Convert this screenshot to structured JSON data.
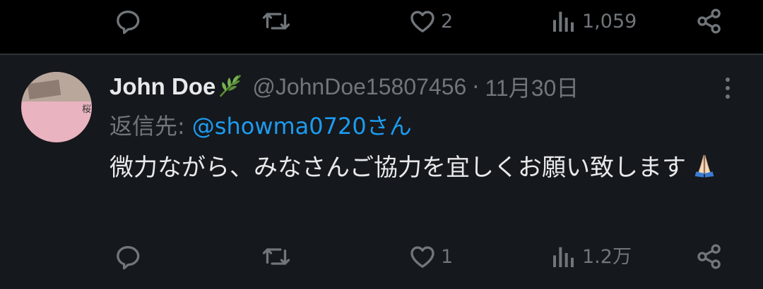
{
  "previous_tweet": {
    "actions": {
      "reply": {
        "icon": "reply-icon",
        "count": ""
      },
      "retweet": {
        "icon": "retweet-icon",
        "count": ""
      },
      "like": {
        "icon": "heart-icon",
        "count": "2"
      },
      "views": {
        "icon": "views-icon",
        "count": "1,059"
      },
      "share": {
        "icon": "share-icon"
      }
    }
  },
  "tweet": {
    "author": {
      "display_name": "John Doe",
      "name_emoji": "leaf-icon",
      "handle": "@JohnDoe15807456",
      "separator": "·",
      "date": "11月30日",
      "avatar_text": "桜"
    },
    "reply_label": "返信先:",
    "reply_target": "@showma0720さん",
    "text": "微力ながら、みなさんご協力を宜しくお願い致します",
    "text_emoji": "folded-hands-icon",
    "actions": {
      "reply": {
        "icon": "reply-icon",
        "count": ""
      },
      "retweet": {
        "icon": "retweet-icon",
        "count": ""
      },
      "like": {
        "icon": "heart-icon",
        "count": "1"
      },
      "views": {
        "icon": "views-icon",
        "count": "1.2万"
      },
      "share": {
        "icon": "share-icon"
      }
    }
  },
  "colors": {
    "background_dim": "#15181c",
    "background_black": "#000000",
    "text_primary": "#e7e9ea",
    "text_secondary": "#71767b",
    "link": "#1d9bf0",
    "border": "#2f3336"
  }
}
